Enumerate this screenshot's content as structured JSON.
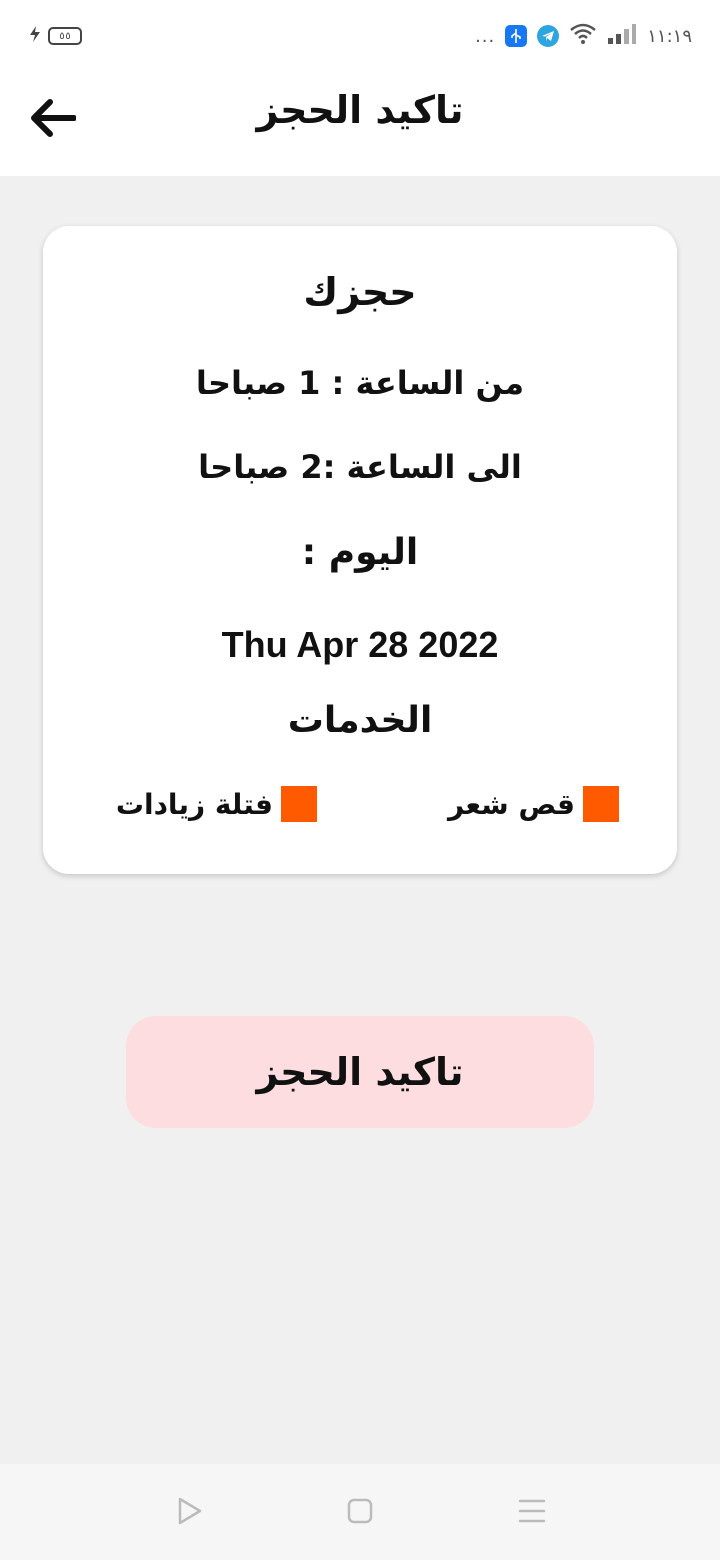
{
  "status_bar": {
    "time": "١١:١٩",
    "battery": "٥٥",
    "more": "..."
  },
  "header": {
    "title": "تاكيد الحجز"
  },
  "booking": {
    "title": "حجزك",
    "from_time": "من الساعة  : 1 صباحا",
    "to_time": "الى الساعة  :2 صباحا",
    "day_label": "اليوم :",
    "date": "Thu Apr 28 2022",
    "services_title": "الخدمات",
    "services": [
      {
        "label": "قص شعر",
        "color": "#ff5a00"
      },
      {
        "label": "فتلة زيادات",
        "color": "#ff5a00"
      }
    ]
  },
  "confirm_button": {
    "label": "تاكيد الحجز"
  },
  "colors": {
    "accent": "#ff5a00",
    "button_bg": "#fddde0",
    "page_bg": "#f0f0f0"
  },
  "icons": {
    "back": "arrow-left-icon",
    "nav_back": "triangle-icon",
    "nav_home": "square-icon",
    "nav_menu": "menu-icon"
  }
}
